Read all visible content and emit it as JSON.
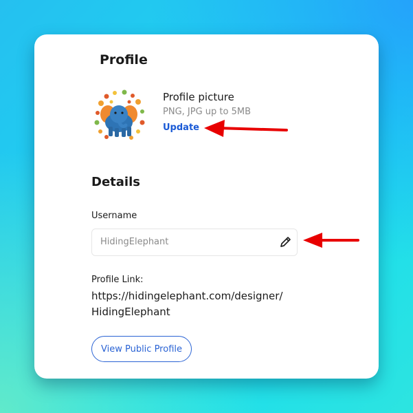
{
  "profile": {
    "title": "Profile",
    "picture": {
      "title": "Profile picture",
      "hint": "PNG, JPG up to 5MB",
      "update_label": "Update"
    }
  },
  "details": {
    "heading": "Details",
    "username": {
      "label": "Username",
      "value": "HidingElephant"
    },
    "profile_link": {
      "label": "Profile Link:",
      "value": "https://hidingelephant.com/designer/HidingElephant"
    },
    "view_button_label": "View Public Profile"
  },
  "icons": {
    "edit": "pencil-icon",
    "annotation": "red-arrow-icon"
  },
  "colors": {
    "accent": "#1a5ad6",
    "annotation": "#e80000"
  }
}
